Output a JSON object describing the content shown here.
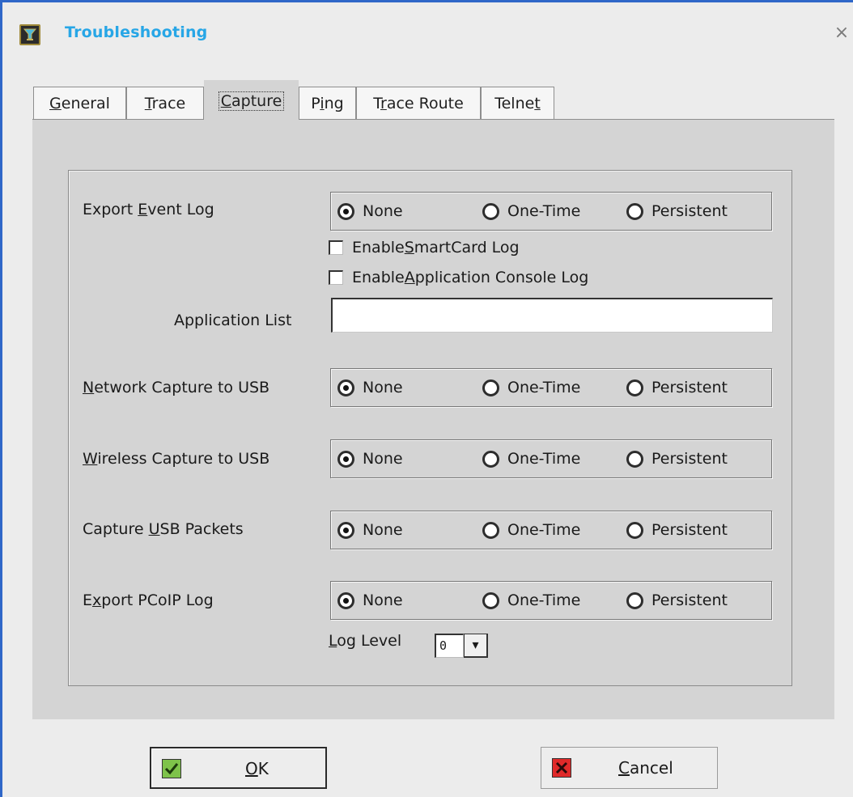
{
  "window": {
    "title": "Troubleshooting",
    "close_glyph": "×",
    "icon": "troubleshooting-app-icon"
  },
  "tabs": [
    {
      "pre": "",
      "u": "G",
      "post": "eneral"
    },
    {
      "pre": "",
      "u": "T",
      "post": "race"
    },
    {
      "pre": "",
      "u": "C",
      "post": "apture",
      "active": true
    },
    {
      "pre": "P",
      "u": "i",
      "post": "ng"
    },
    {
      "pre": "T",
      "u": "r",
      "post": "ace Route"
    },
    {
      "pre": "Telne",
      "u": "t",
      "post": ""
    }
  ],
  "capture": {
    "radio_options": [
      "None",
      "One-Time",
      "Persistent"
    ],
    "export_event_log": {
      "pre": "Export ",
      "u": "E",
      "post": "vent Log",
      "selected": "None"
    },
    "smartcard_log": {
      "pre": "Enable ",
      "u": "S",
      "post": "martCard Log",
      "checked": false
    },
    "app_console_log": {
      "pre": "Enable ",
      "u": "A",
      "post": "pplication Console Log",
      "checked": false
    },
    "application_list": {
      "label": "Application List",
      "value": ""
    },
    "network_capture": {
      "pre": "",
      "u": "N",
      "post": "etwork Capture to USB",
      "selected": "None"
    },
    "wireless_capture": {
      "pre": "",
      "u": "W",
      "post": "ireless Capture to USB",
      "selected": "None"
    },
    "usb_packets": {
      "pre": "Capture ",
      "u": "U",
      "post": "SB Packets",
      "selected": "None"
    },
    "pcoip_log": {
      "pre": "E",
      "u": "x",
      "post": "port PCoIP Log",
      "selected": "None"
    },
    "log_level": {
      "pre": "",
      "u": "L",
      "post": "og Level",
      "value": "0",
      "spin_glyph": "▾"
    }
  },
  "buttons": {
    "ok": {
      "u": "O",
      "post": "K",
      "icon": "checkmark-icon"
    },
    "cancel": {
      "u": "C",
      "post": "ancel",
      "icon": "cancel-x-icon"
    }
  },
  "colors": {
    "title": "#27a6e6",
    "window_border": "#2f67c8",
    "panel": "#d4d4d4",
    "ok_icon": "#7ec34a",
    "cancel_icon": "#e02a2a"
  }
}
